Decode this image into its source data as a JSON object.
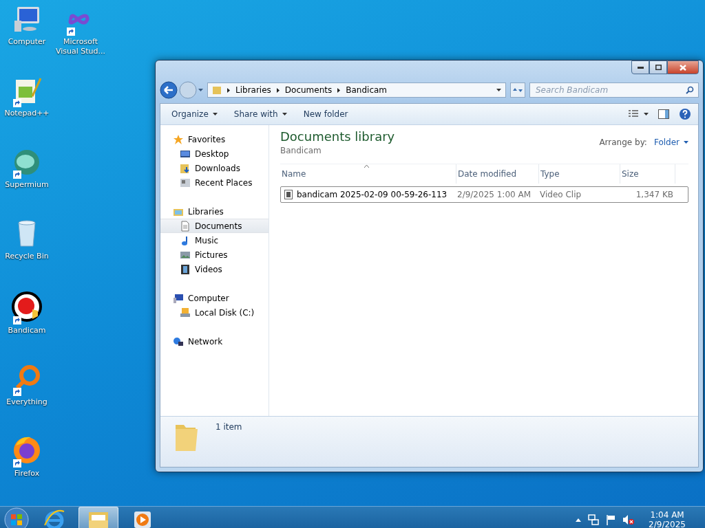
{
  "desktop_icons": [
    {
      "label": "Computer",
      "kind": "computer",
      "shortcut": false
    },
    {
      "label": "Notepad++",
      "kind": "notepad",
      "shortcut": true
    },
    {
      "label": "Supermium",
      "kind": "supermium",
      "shortcut": true
    },
    {
      "label": "Recycle Bin",
      "kind": "recycle",
      "shortcut": false
    },
    {
      "label": "Bandicam",
      "kind": "bandicam",
      "shortcut": true
    },
    {
      "label": "Everything",
      "kind": "everything",
      "shortcut": true
    },
    {
      "label": "Firefox",
      "kind": "firefox",
      "shortcut": true
    },
    {
      "label": "Microsoft Visual Stud...",
      "kind": "vs",
      "shortcut": true
    }
  ],
  "window": {
    "breadcrumb": [
      "Libraries",
      "Documents",
      "Bandicam"
    ],
    "search": {
      "placeholder": "Search Bandicam"
    },
    "toolbar": [
      {
        "label": "Organize",
        "dropdown": true
      },
      {
        "label": "Share with",
        "dropdown": true
      },
      {
        "label": "New folder",
        "dropdown": false
      }
    ],
    "sidebar": {
      "groups": [
        {
          "label": "Favorites",
          "kind": "star",
          "children": [
            {
              "label": "Desktop",
              "kind": "desktop",
              "selected": false
            },
            {
              "label": "Downloads",
              "kind": "downloads",
              "selected": false
            },
            {
              "label": "Recent Places",
              "kind": "recent",
              "selected": false
            }
          ]
        },
        {
          "label": "Libraries",
          "kind": "library",
          "children": [
            {
              "label": "Documents",
              "kind": "document",
              "selected": true
            },
            {
              "label": "Music",
              "kind": "music",
              "selected": false
            },
            {
              "label": "Pictures",
              "kind": "pictures",
              "selected": false
            },
            {
              "label": "Videos",
              "kind": "videos",
              "selected": false
            }
          ]
        },
        {
          "label": "Computer",
          "kind": "computer",
          "children": [
            {
              "label": "Local Disk (C:)",
              "kind": "disk",
              "selected": false
            }
          ]
        },
        {
          "label": "Network",
          "kind": "network"
        }
      ]
    },
    "library": {
      "title": "Documents library",
      "subtitle": "Bandicam",
      "arrange_label": "Arrange by:",
      "arrange_value": "Folder"
    },
    "table": {
      "columns": [
        {
          "label": "Name",
          "sorted": true
        },
        {
          "label": "Date modified",
          "sorted": false
        },
        {
          "label": "Type",
          "sorted": false
        },
        {
          "label": "Size",
          "sorted": false
        }
      ],
      "rows": [
        {
          "name": "bandicam 2025-02-09 00-59-26-113",
          "date": "2/9/2025 1:00 AM",
          "type": "Video Clip",
          "size": "1,347 KB",
          "selected": true
        }
      ]
    },
    "status": "1 item"
  },
  "taskbar": {
    "items": [
      {
        "kind": "ie",
        "active": false
      },
      {
        "kind": "explorer",
        "active": true
      },
      {
        "kind": "player",
        "active": false
      }
    ],
    "time": "1:04 AM",
    "date": "2/9/2025"
  }
}
